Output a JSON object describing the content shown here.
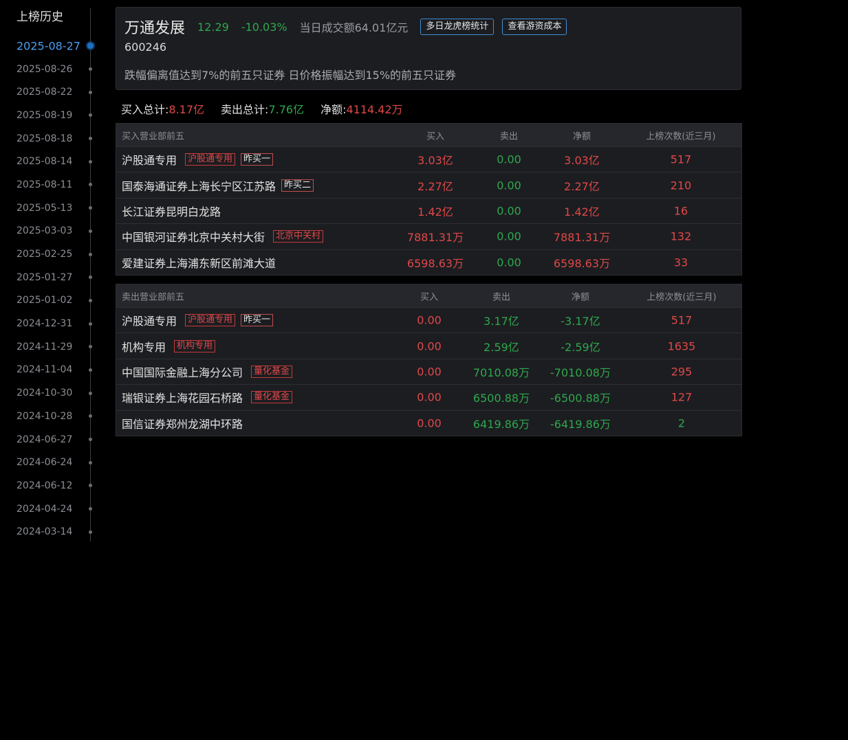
{
  "history": {
    "title": "上榜历史",
    "dates": [
      "2025-08-27",
      "2025-08-26",
      "2025-08-22",
      "2025-08-19",
      "2025-08-18",
      "2025-08-14",
      "2025-08-11",
      "2025-05-13",
      "2025-03-03",
      "2025-02-25",
      "2025-01-27",
      "2025-01-02",
      "2024-12-31",
      "2024-11-29",
      "2024-11-04",
      "2024-10-30",
      "2024-10-28",
      "2024-06-27",
      "2024-06-24",
      "2024-06-12",
      "2024-04-24",
      "2024-03-14"
    ]
  },
  "stock": {
    "name": "万通发展",
    "price": "12.29",
    "change": "-10.03%",
    "turnover": "当日成交额64.01亿元",
    "code": "600246",
    "reason": "跌幅偏离值达到7%的前五只证券 日价格振幅达到15%的前五只证券",
    "buttons": {
      "multi_day": "多日龙虎榜统计",
      "cost": "查看游资成本"
    }
  },
  "totals": {
    "buy_label": "买入总计:",
    "buy_value": "8.17亿",
    "sell_label": "卖出总计:",
    "sell_value": "7.76亿",
    "net_label": "净额:",
    "net_value": "4114.42万"
  },
  "buy_table": {
    "headers": {
      "name": "买入营业部前五",
      "buy": "买入",
      "sell": "卖出",
      "net": "净额",
      "count": "上榜次数(近三月)"
    },
    "rows": [
      {
        "name": "沪股通专用",
        "tag": "沪股通专用",
        "tag2": "昨买一",
        "buy": "3.03亿",
        "sell": "0.00",
        "net": "3.03亿",
        "count": "517"
      },
      {
        "name": "国泰海通证券上海长宁区江苏路",
        "tag": "",
        "tag2": "昨买二",
        "buy": "2.27亿",
        "sell": "0.00",
        "net": "2.27亿",
        "count": "210"
      },
      {
        "name": "长江证券昆明白龙路",
        "tag": "",
        "tag2": "",
        "buy": "1.42亿",
        "sell": "0.00",
        "net": "1.42亿",
        "count": "16"
      },
      {
        "name": "中国银河证券北京中关村大街",
        "tag": "北京中关村",
        "tag2": "",
        "buy": "7881.31万",
        "sell": "0.00",
        "net": "7881.31万",
        "count": "132"
      },
      {
        "name": "爱建证券上海浦东新区前滩大道",
        "tag": "",
        "tag2": "",
        "buy": "6598.63万",
        "sell": "0.00",
        "net": "6598.63万",
        "count": "33"
      }
    ]
  },
  "sell_table": {
    "headers": {
      "name": "卖出营业部前五",
      "buy": "买入",
      "sell": "卖出",
      "net": "净额",
      "count": "上榜次数(近三月)"
    },
    "rows": [
      {
        "name": "沪股通专用",
        "tag": "沪股通专用",
        "tag2": "昨买一",
        "buy": "0.00",
        "sell": "3.17亿",
        "net": "-3.17亿",
        "count": "517"
      },
      {
        "name": "机构专用",
        "tag": "机构专用",
        "tag2": "",
        "buy": "0.00",
        "sell": "2.59亿",
        "net": "-2.59亿",
        "count": "1635"
      },
      {
        "name": "中国国际金融上海分公司",
        "tag": "量化基金",
        "tag2": "",
        "buy": "0.00",
        "sell": "7010.08万",
        "net": "-7010.08万",
        "count": "295"
      },
      {
        "name": "瑞银证券上海花园石桥路",
        "tag": "量化基金",
        "tag2": "",
        "buy": "0.00",
        "sell": "6500.88万",
        "net": "-6500.88万",
        "count": "127"
      },
      {
        "name": "国信证券郑州龙湖中环路",
        "tag": "",
        "tag2": "",
        "buy": "0.00",
        "sell": "6419.86万",
        "net": "-6419.86万",
        "count": "2"
      }
    ]
  },
  "colors": {
    "up": "#e04848",
    "down": "#2ea84c",
    "accent": "#4a9ff0"
  }
}
